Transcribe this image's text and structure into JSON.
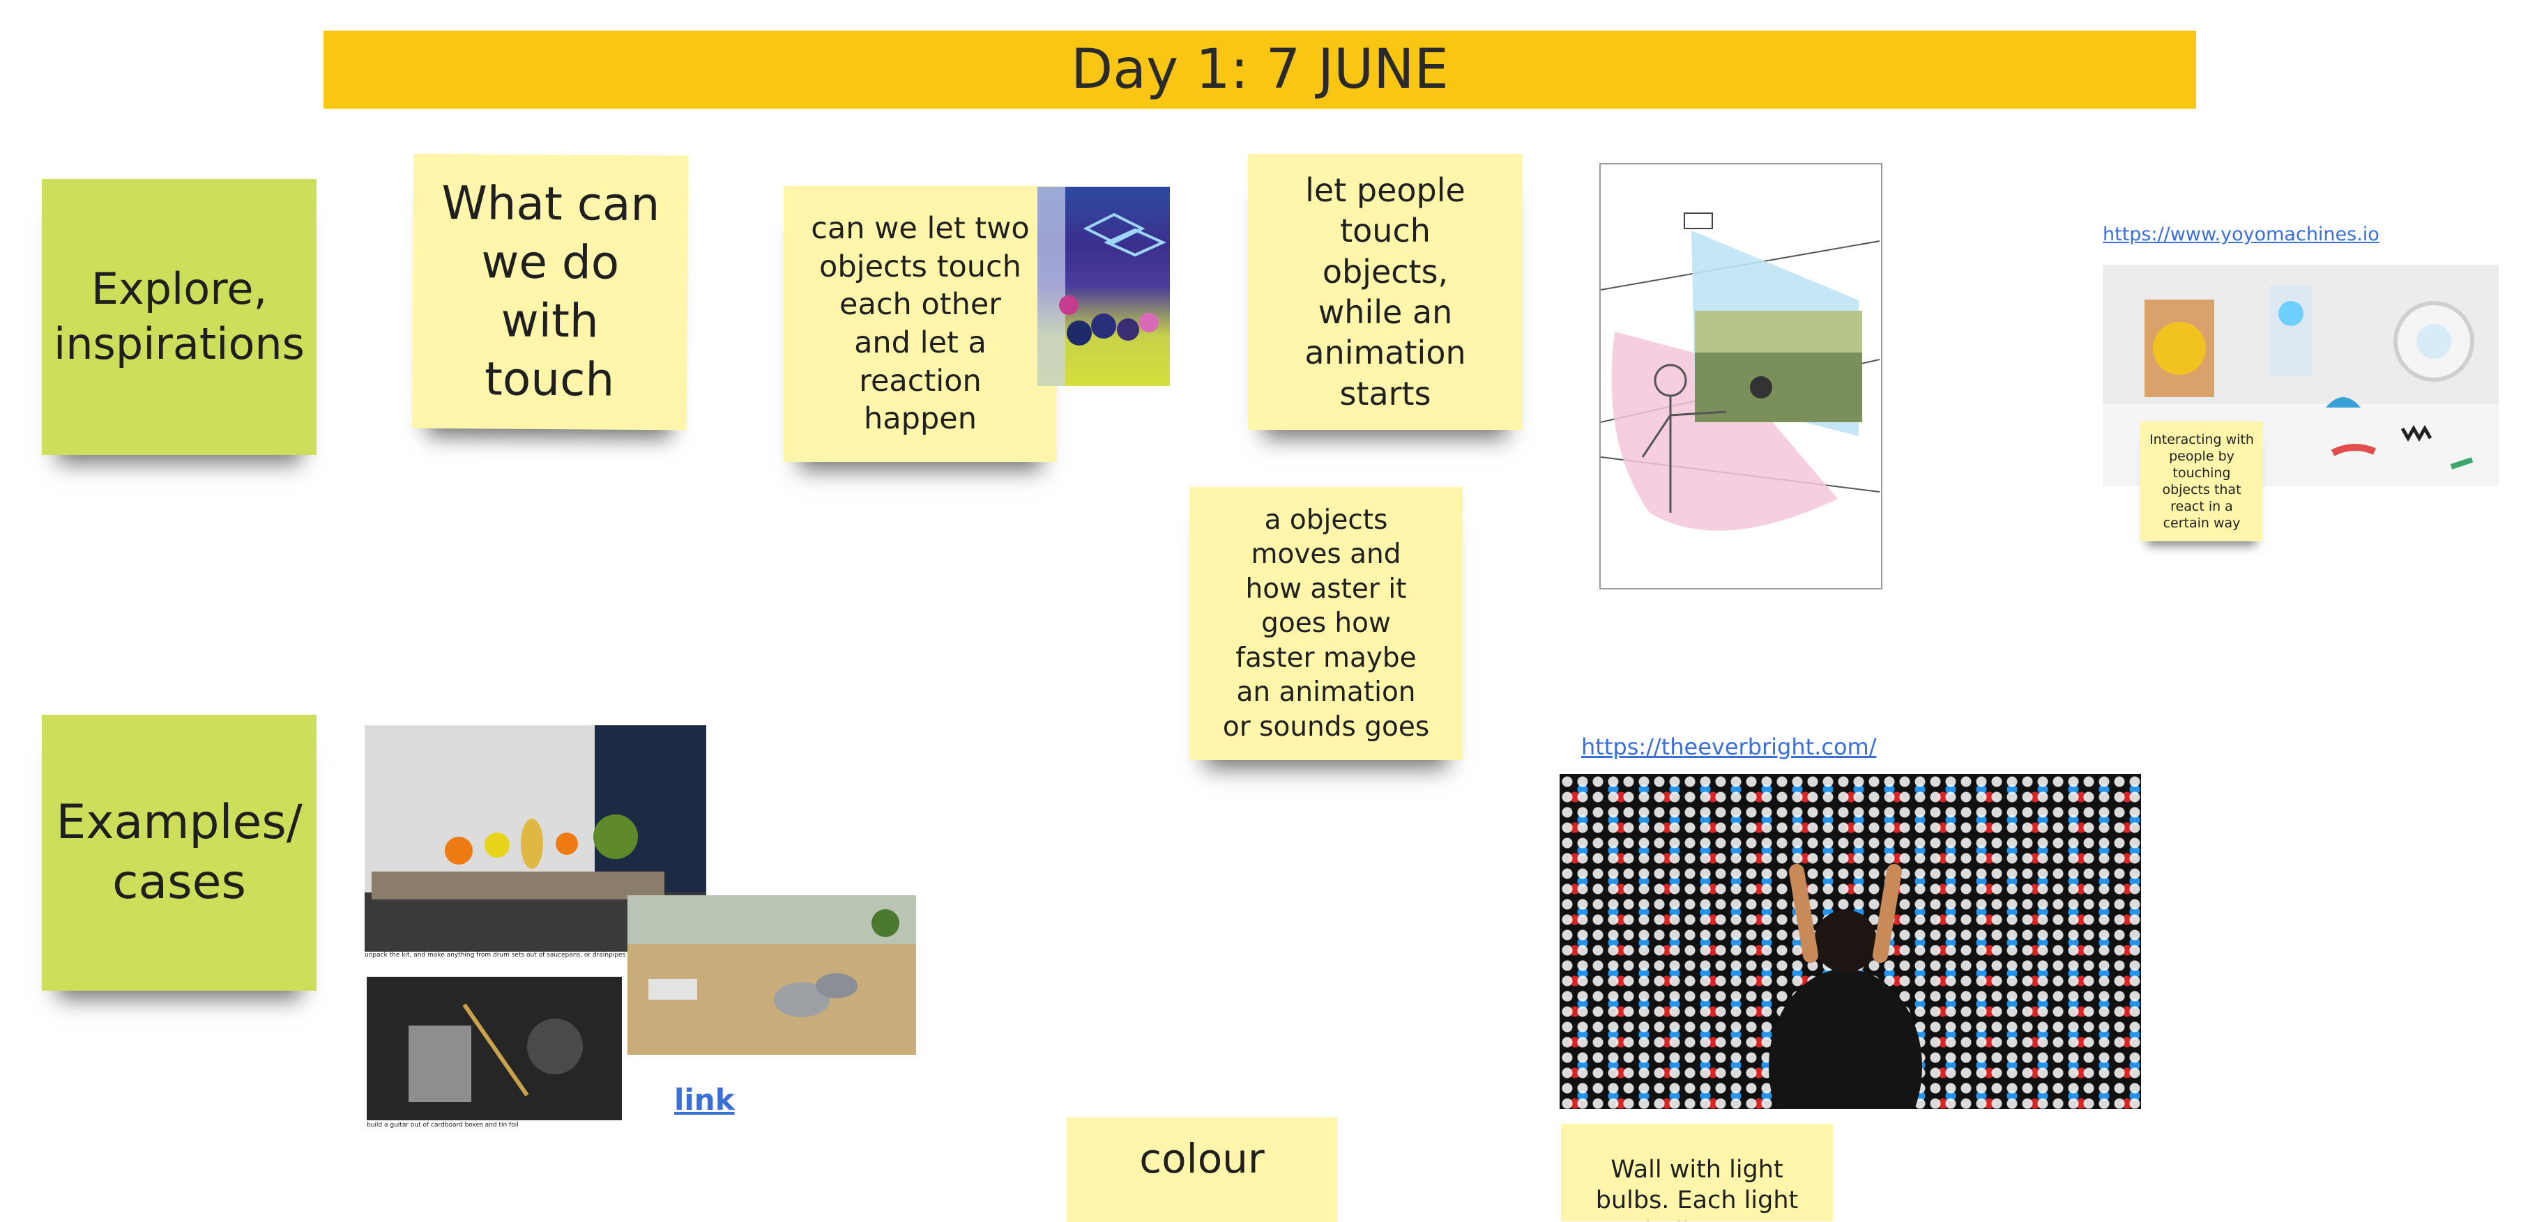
{
  "banner": {
    "title": "Day 1: 7 JUNE"
  },
  "stickies": {
    "explore": "Explore, inspirations",
    "what_touch": "What can we do with touch",
    "two_objects": "can we let two objects touch each other and let a reaction happen",
    "let_people": "let people touch objects, while an animation starts",
    "objects_moves": "a objects moves and how aster it goes how faster maybe an animation or sounds goes",
    "interacting": "Interacting with people by touching objects that react in a certain way",
    "examples": "Examples/ cases",
    "colour": "colour",
    "wall": "Wall with light bulbs. Each light bulb can"
  },
  "links": {
    "yoyo": "https://www.yoyomachines.io",
    "everbright": "https://theeverbright.com/",
    "link": "link"
  },
  "captions": {
    "kit": "unpack the kit, and make anything from drum sets out of saucepans, or drainpipes",
    "guitar": "build a guitar out of cardboard boxes and tin foil"
  },
  "colors": {
    "banner": "#f9c713",
    "sticky_green": "#cddf5a",
    "sticky_yellow": "#fff6ac",
    "link": "#3a6fd8"
  }
}
